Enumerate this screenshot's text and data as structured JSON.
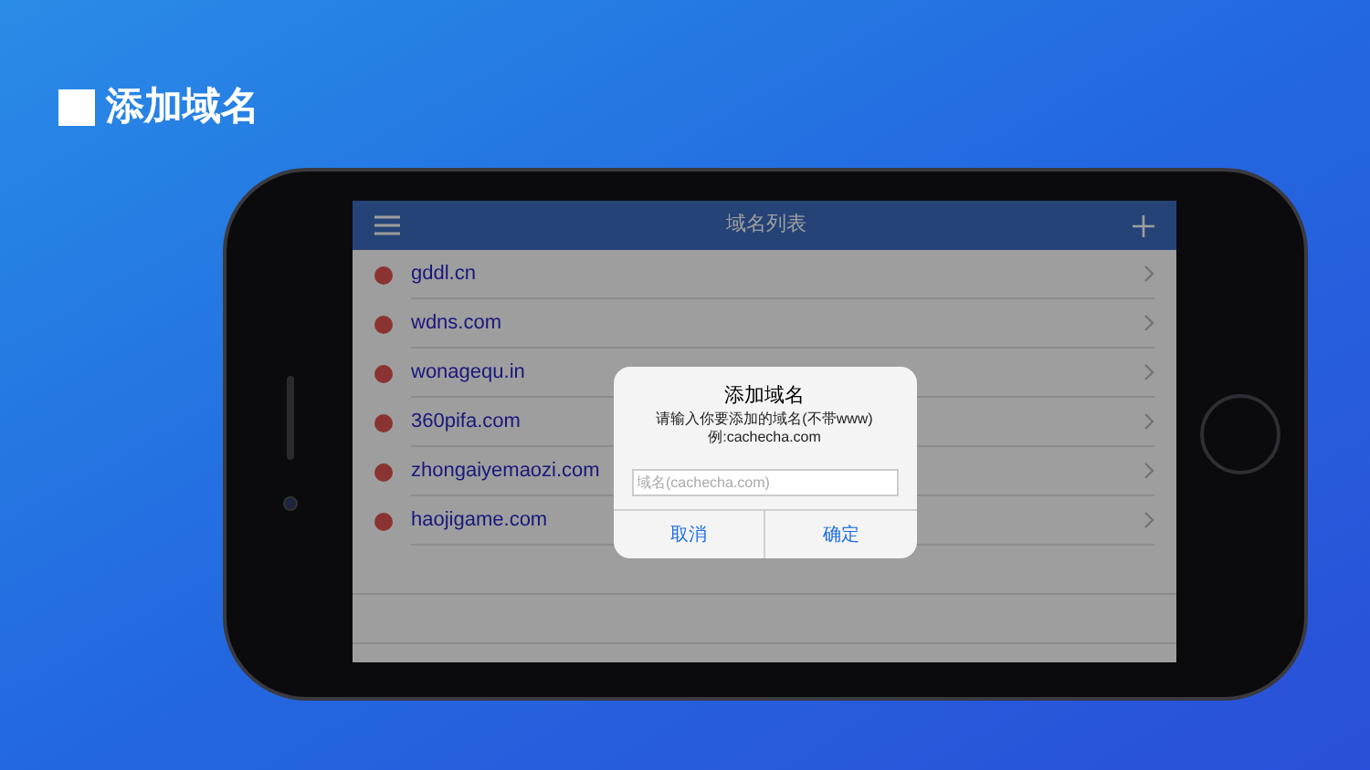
{
  "heading": "添加域名",
  "app": {
    "title": "域名列表"
  },
  "domains": [
    {
      "name": "gddl.cn"
    },
    {
      "name": "wdns.com"
    },
    {
      "name": "wonagequ.in"
    },
    {
      "name": "360pifa.com"
    },
    {
      "name": "zhongaiyemaozi.com"
    },
    {
      "name": "haojigame.com"
    }
  ],
  "dialog": {
    "title": "添加域名",
    "message": "请输入你要添加的域名(不带www)",
    "example": "例:cachecha.com",
    "placeholder": "域名(cachecha.com)",
    "buttons": [
      "取消",
      "确定"
    ]
  }
}
